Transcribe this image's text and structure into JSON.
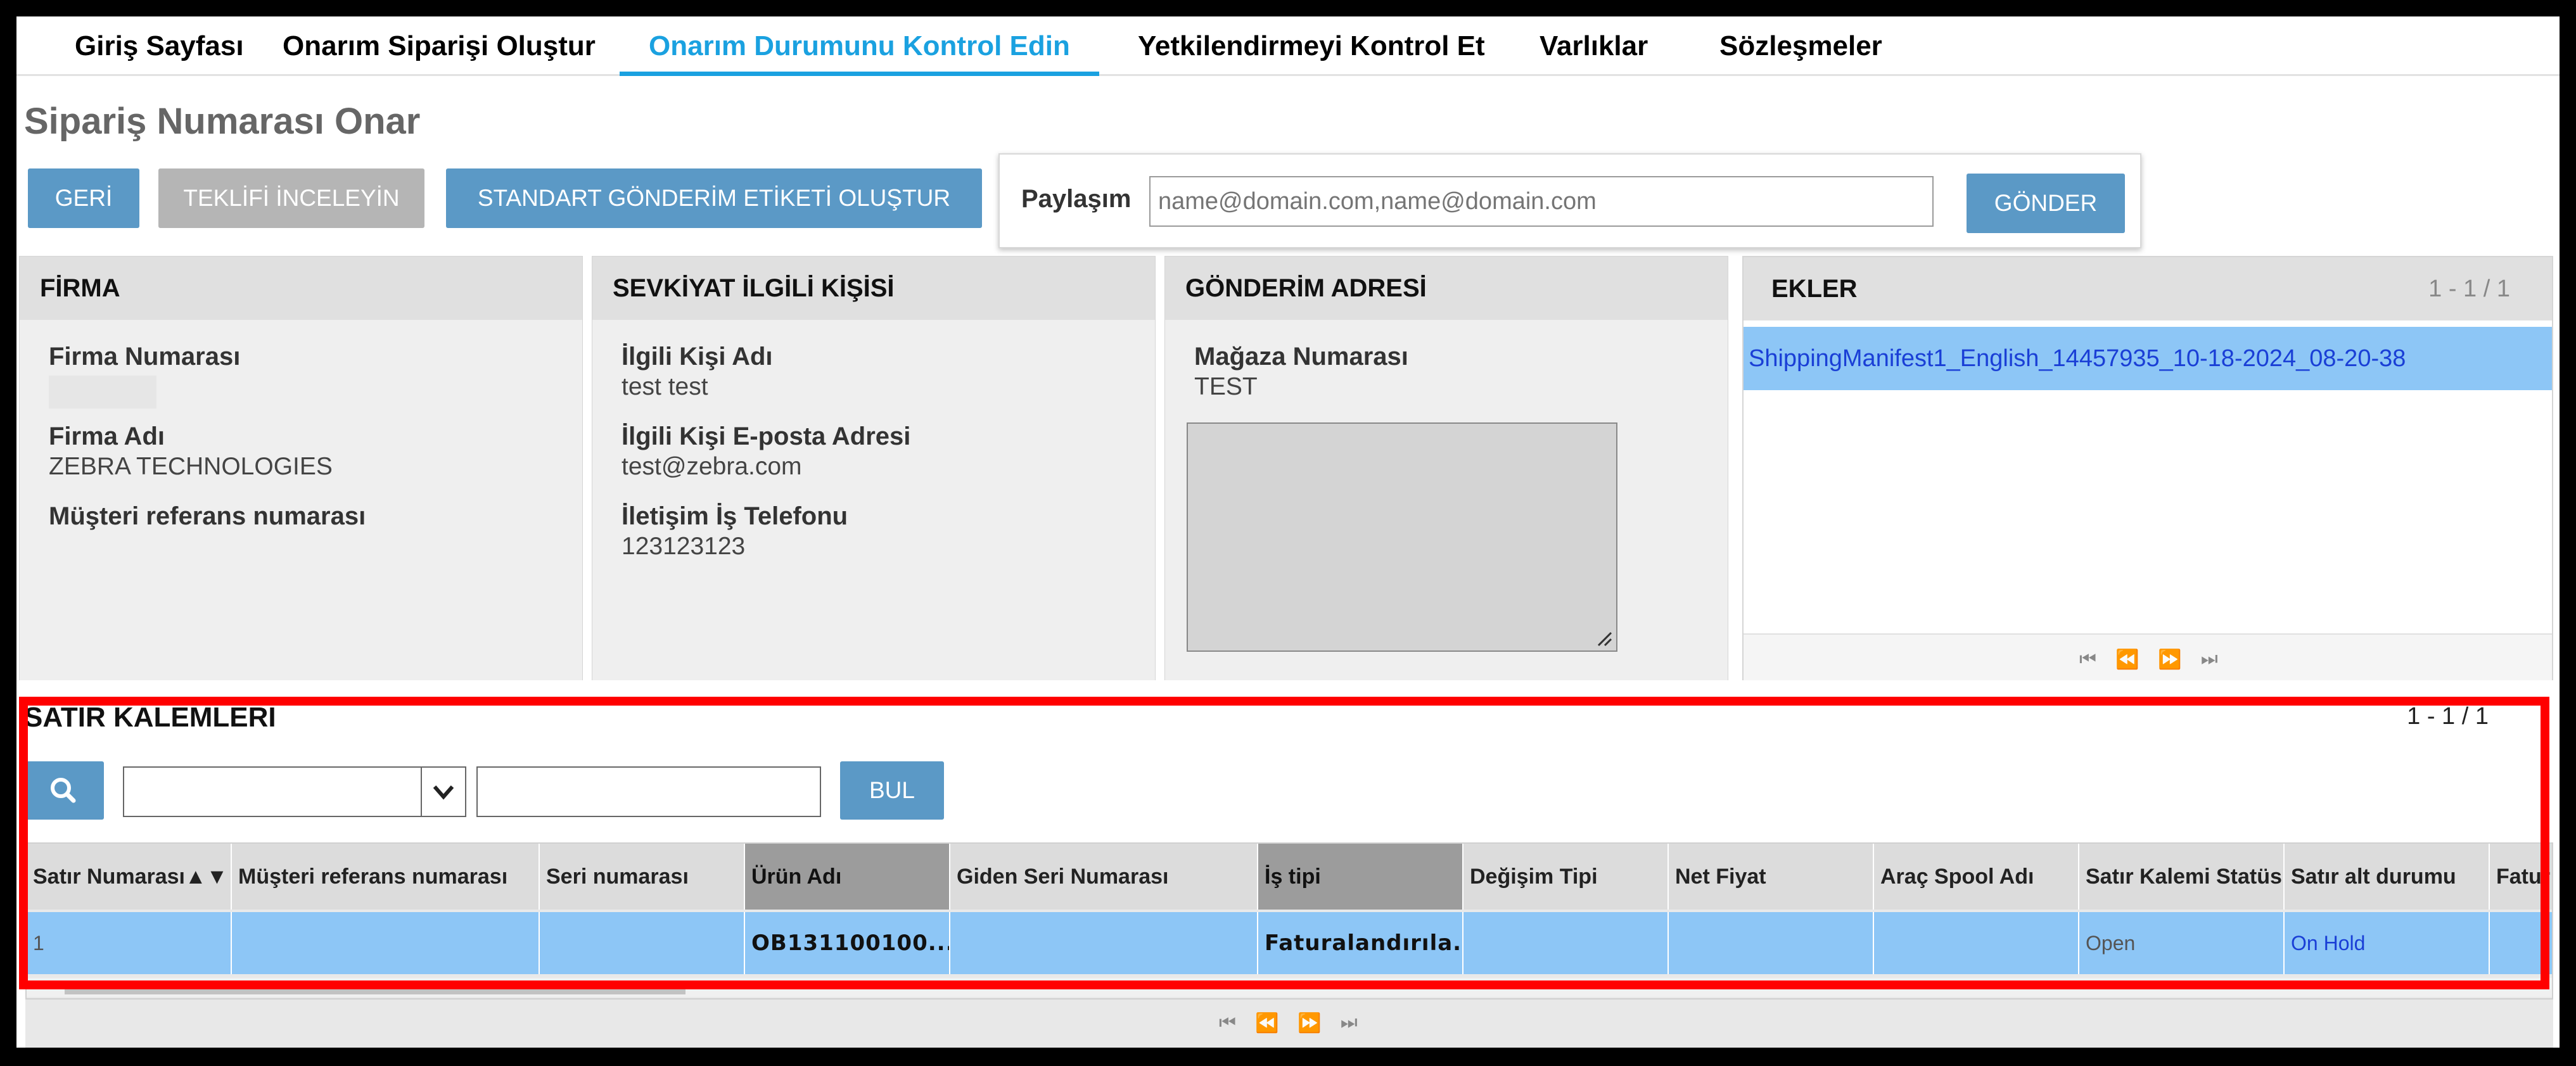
{
  "nav": {
    "tabs": [
      {
        "label": "Giriş Sayfası"
      },
      {
        "label": "Onarım Siparişi Oluştur"
      },
      {
        "label": "Onarım Durumunu Kontrol Edin"
      },
      {
        "label": "Yetkilendirmeyi Kontrol Et"
      },
      {
        "label": "Varlıklar"
      },
      {
        "label": "Sözleşmeler"
      }
    ],
    "active_index": 2
  },
  "page": {
    "title": "Sipariş Numarası Onar"
  },
  "toolbar": {
    "back_label": "GERİ",
    "review_quote_label": "TEKLİFİ İNCELEYİN",
    "shipping_label_label": "STANDART GÖNDERİM ETİKETİ OLUŞTUR"
  },
  "share": {
    "label": "Paylaşım",
    "placeholder": "name@domain.com,name@domain.com",
    "send_label": "GÖNDER"
  },
  "company": {
    "header": "FİRMA",
    "number_label": "Firma Numarası",
    "number_value": "",
    "name_label": "Firma Adı",
    "name_value": "ZEBRA TECHNOLOGIES",
    "customer_ref_label": "Müşteri referans numarası"
  },
  "contact": {
    "header": "SEVKİYAT İLGİLİ KİŞİSİ",
    "name_label": "İlgili Kişi Adı",
    "name_value": "test test",
    "email_label": "İlgili Kişi E-posta Adresi",
    "email_value": "test@zebra.com",
    "phone_label": "İletişim İş Telefonu",
    "phone_value": "123123123"
  },
  "shipping_address": {
    "header": "GÖNDERİM ADRESİ",
    "store_label": "Mağaza Numarası",
    "store_value": "TEST"
  },
  "attachments": {
    "header": "EKLER",
    "count": "1 - 1 / 1",
    "items": [
      "ShippingManifest1_English_14457935_10-18-2024_08-20-38"
    ]
  },
  "line_items": {
    "header": "SATIR KALEMLERİ",
    "count": "1 - 1 / 1",
    "find_label": "BUL",
    "columns": [
      "Satır Numarası",
      "Müşteri referans numarası",
      "Seri numarası",
      "Ürün Adı",
      "Giden Seri Numarası",
      "İş tipi",
      "Değişim Tipi",
      "Net Fiyat",
      "Araç Spool Adı",
      "Satır Kalemi Statüs",
      "Satır alt durumu",
      "Fatur"
    ],
    "rows": [
      {
        "line_no": "1",
        "customer_ref": "",
        "serial": "",
        "product": "OB131100100...",
        "out_serial": "",
        "job_type": "Faturalandırıla...",
        "exchange_type": "",
        "net_price": "",
        "spool_name": "",
        "status": "Open",
        "sub_status": "On Hold",
        "invoice": ""
      }
    ]
  },
  "colors": {
    "accent": "#1aa1e0",
    "button": "#5b99c6",
    "button_disabled": "#b5b5b5",
    "row_selected": "#8dc6f6",
    "highlight_border": "#ff0000"
  }
}
